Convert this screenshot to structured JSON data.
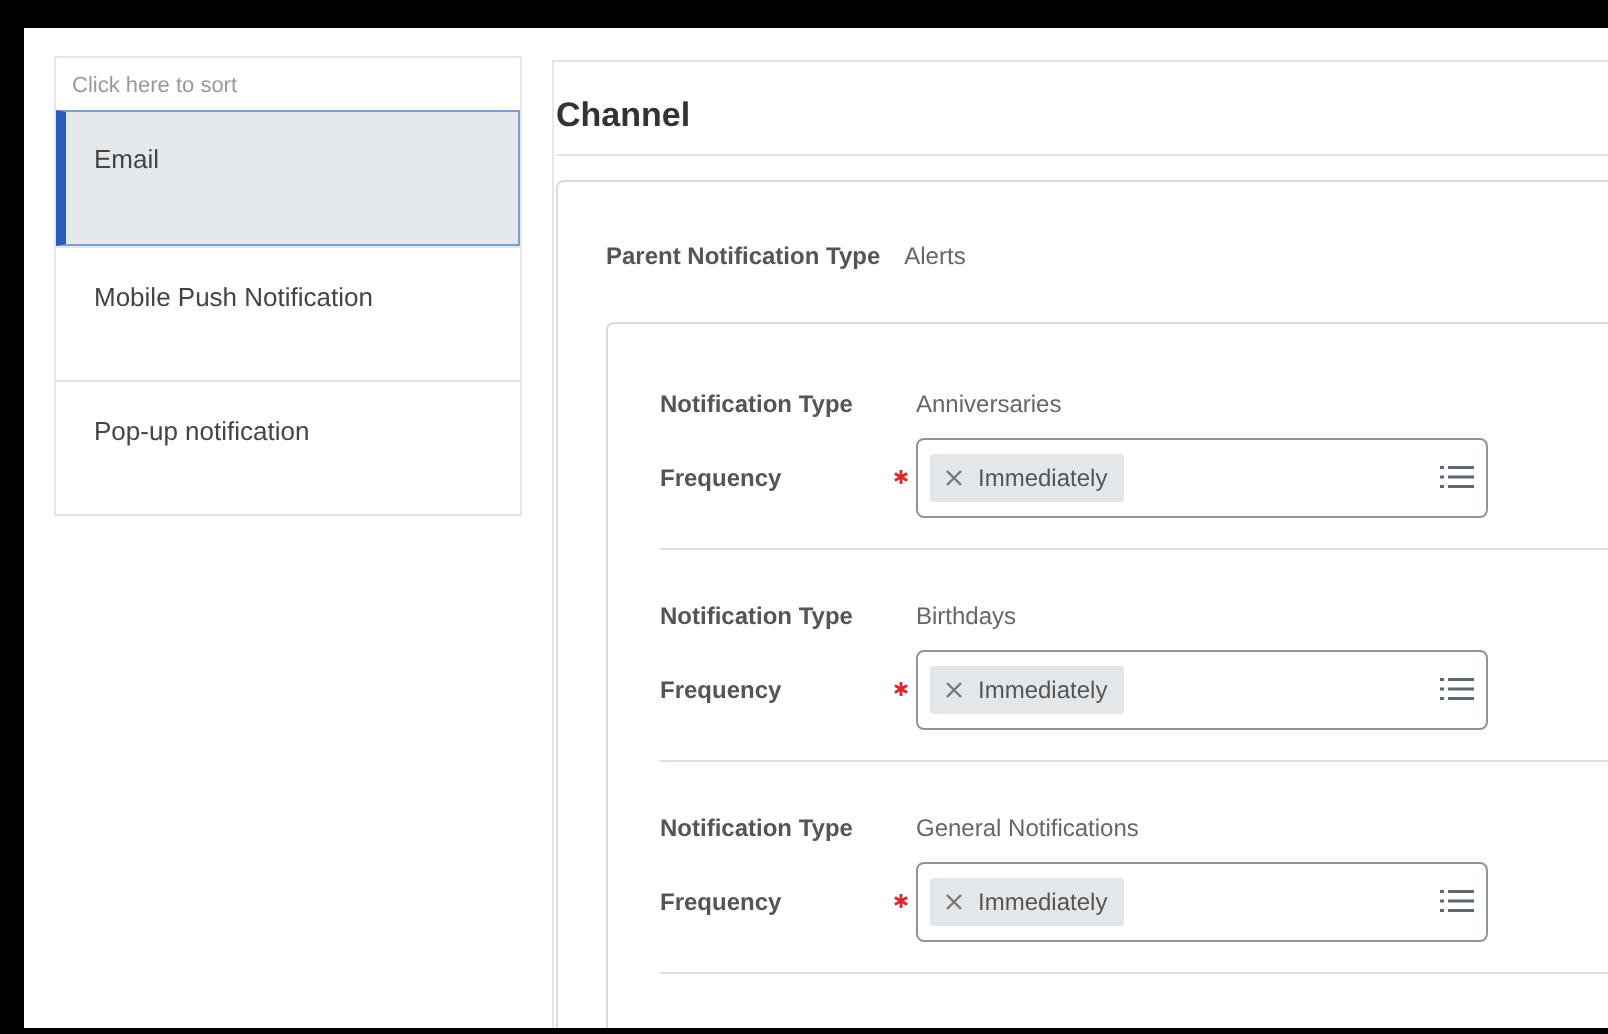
{
  "sidebar": {
    "sort_hint": "Click here to sort",
    "items": [
      {
        "label": "Email",
        "selected": true
      },
      {
        "label": "Mobile Push Notification",
        "selected": false
      },
      {
        "label": "Pop-up notification",
        "selected": false
      }
    ]
  },
  "section_title": "Channel",
  "parent_notification_type": {
    "label": "Parent Notification Type",
    "value": "Alerts"
  },
  "notification_types": [
    {
      "type_label": "Notification Type",
      "type_value": "Anniversaries",
      "frequency_label": "Frequency",
      "required": true,
      "chips": [
        "Immediately"
      ]
    },
    {
      "type_label": "Notification Type",
      "type_value": "Birthdays",
      "frequency_label": "Frequency",
      "required": true,
      "chips": [
        "Immediately"
      ]
    },
    {
      "type_label": "Notification Type",
      "type_value": "General Notifications",
      "frequency_label": "Frequency",
      "required": true,
      "chips": [
        "Immediately"
      ]
    }
  ]
}
